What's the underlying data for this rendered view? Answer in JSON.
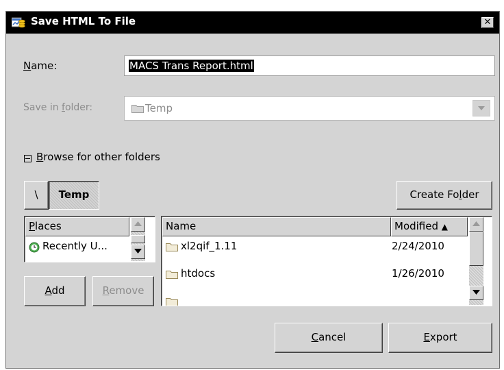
{
  "window": {
    "title": "Save HTML To File",
    "close_label": "✕"
  },
  "name_field": {
    "label_prefix": "",
    "label_mnemonic": "N",
    "label_rest": "ame:",
    "value": "MACS Trans Report.html"
  },
  "save_in": {
    "label_a": "Save in ",
    "label_mnemonic": "f",
    "label_b": "older:",
    "value": "Temp"
  },
  "browse": {
    "mnemonic": "B",
    "rest": "rowse for other folders"
  },
  "path_bar": {
    "root": "\\",
    "current": "Temp"
  },
  "create_folder": {
    "a": "Create Fo",
    "mnemonic": "l",
    "b": "der"
  },
  "places": {
    "header_mnemonic": "P",
    "header_rest": "laces",
    "items": [
      {
        "label": "Recently U...",
        "icon": "recent-icon"
      }
    ]
  },
  "add_button": {
    "mnemonic": "A",
    "rest": "dd"
  },
  "remove_button": {
    "mnemonic": "R",
    "rest": "emove"
  },
  "files": {
    "col_name": "Name",
    "col_modified": "Modified",
    "sort_indicator": "▲",
    "rows": [
      {
        "name": "xl2qif_1.11",
        "modified": "2/24/2010",
        "icon": "folder-icon"
      },
      {
        "name": "htdocs",
        "modified": "1/26/2010",
        "icon": "folder-icon"
      }
    ]
  },
  "cancel_button": {
    "mnemonic": "C",
    "rest": "ancel"
  },
  "export_button": {
    "mnemonic": "E",
    "rest": "xport"
  },
  "colors": {
    "title_bar": "#000000",
    "dialog_bg": "#d4d4d4",
    "selection": "#000000",
    "folder": "#c9b98a"
  }
}
